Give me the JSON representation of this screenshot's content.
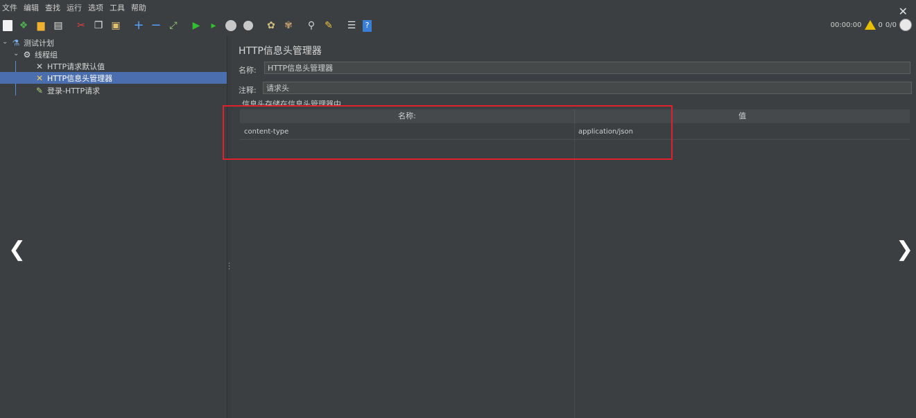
{
  "menu": [
    "文件",
    "编辑",
    "查找",
    "运行",
    "选项",
    "工具",
    "帮助"
  ],
  "toolbar_icons": [
    "new-icon",
    "templates-icon",
    "open-icon",
    "save-icon",
    "cut-icon",
    "copy-icon",
    "paste-icon",
    "expand-icon",
    "collapse-icon",
    "toggle-icon",
    "start-icon",
    "start-no-pause-icon",
    "stop-icon",
    "shutdown-icon",
    "clear-icon",
    "clear-all-icon",
    "search-icon",
    "reset-search-icon",
    "function-helper-icon",
    "help-icon"
  ],
  "status": {
    "timer": "00:00:00",
    "warnings": "0",
    "threads": "0/0"
  },
  "tree": {
    "test_plan": "测试计划",
    "thread_group": "线程组",
    "items": [
      "HTTP请求默认值",
      "HTTP信息头管理器",
      "登录-HTTP请求"
    ]
  },
  "panel": {
    "title": "HTTP信息头管理器",
    "name_label": "名称:",
    "name_value": "HTTP信息头管理器",
    "comment_label": "注释:",
    "comment_value": "请求头",
    "hint": "信息头存储在信息头管理器中"
  },
  "table": {
    "headers": [
      "名称:",
      "值"
    ],
    "rows": [
      {
        "name": "content-type",
        "value": "application/json"
      }
    ]
  },
  "colors": {
    "background": "#3c3f41",
    "selection": "#4b6eaf",
    "highlight_box": "#e0202a"
  }
}
